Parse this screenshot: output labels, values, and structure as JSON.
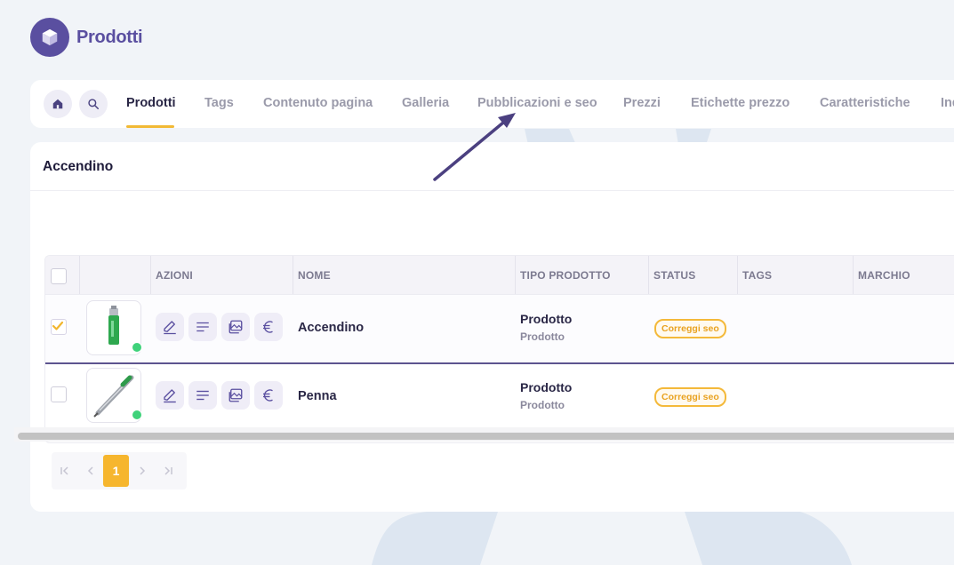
{
  "header": {
    "title": "Prodotti",
    "logo_icon": "cube-icon"
  },
  "nav": {
    "tabs": [
      {
        "label": "Prodotti",
        "active": true
      },
      {
        "label": "Tags"
      },
      {
        "label": "Contenuto pagina"
      },
      {
        "label": "Galleria"
      },
      {
        "label": "Pubblicazioni e seo"
      },
      {
        "label": "Prezzi"
      },
      {
        "label": "Etichette prezzo"
      },
      {
        "label": "Caratteristiche"
      },
      {
        "label": "Ind"
      }
    ]
  },
  "card": {
    "title": "Accendino"
  },
  "table": {
    "columns": [
      "AZIONI",
      "NOME",
      "TIPO PRODOTTO",
      "STATUS",
      "TAGS",
      "MARCHIO"
    ],
    "rows": [
      {
        "selected": true,
        "name": "Accendino",
        "type": "Prodotto",
        "type_sub": "Prodotto",
        "status": "Correggi seo",
        "online": true
      },
      {
        "selected": false,
        "name": "Penna",
        "type": "Prodotto",
        "type_sub": "Prodotto",
        "status": "Correggi seo",
        "online": true
      }
    ]
  },
  "pagination": {
    "current_page": "1"
  },
  "colors": {
    "brand": "#5a4fa0",
    "accent": "#f6b62e",
    "status_online": "#3fd27a"
  }
}
